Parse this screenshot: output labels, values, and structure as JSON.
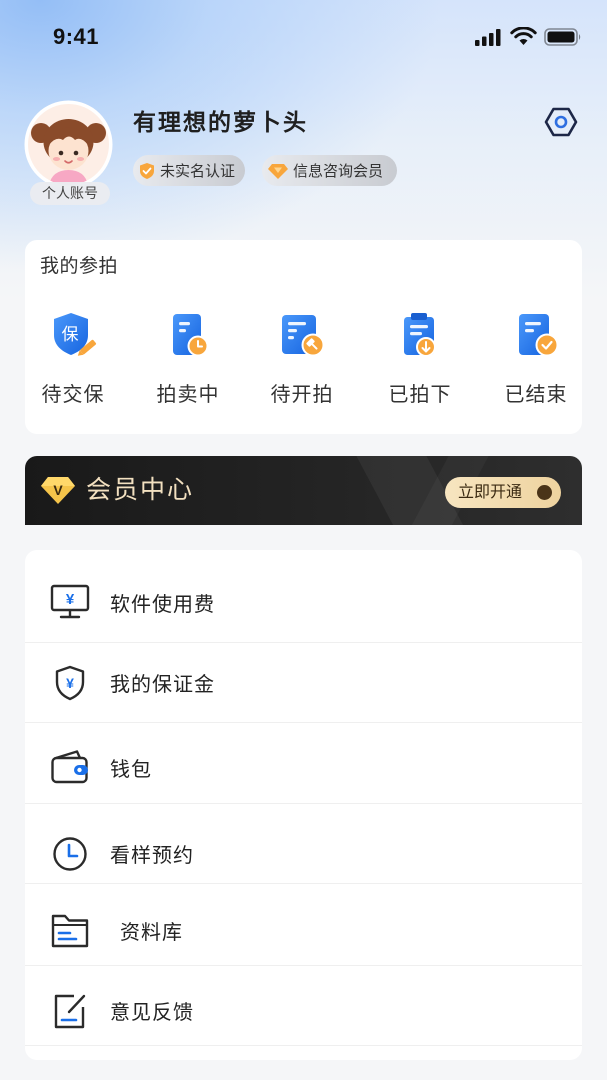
{
  "status_bar": {
    "time": "9:41"
  },
  "profile": {
    "username": "有理想的萝卜头",
    "account_label": "个人账号",
    "badges": [
      {
        "label": "未实名认证",
        "icon": "shield-icon"
      },
      {
        "label": "信息咨询会员",
        "icon": "diamond-icon"
      }
    ],
    "settings_icon": "settings-hexagon-icon"
  },
  "auction": {
    "title": "我的参拍",
    "items": [
      {
        "label": "待交保",
        "icon": "deposit-shield-icon",
        "glyph": "保"
      },
      {
        "label": "拍卖中",
        "icon": "document-clock-icon"
      },
      {
        "label": "待开拍",
        "icon": "document-hammer-icon"
      },
      {
        "label": "已拍下",
        "icon": "clipboard-download-icon"
      },
      {
        "label": "已结束",
        "icon": "document-check-icon"
      }
    ]
  },
  "membership": {
    "title": "会员中心",
    "badge_letter": "V",
    "cta_label": "立即开通"
  },
  "menu": {
    "currency_symbol": "¥",
    "items": [
      {
        "label": "软件使用费",
        "icon": "monitor-yen-icon"
      },
      {
        "label": "我的保证金",
        "icon": "shield-yen-icon"
      },
      {
        "label": "钱包",
        "icon": "wallet-icon"
      },
      {
        "label": "看样预约",
        "icon": "clock-icon"
      },
      {
        "label": "资料库",
        "icon": "folder-icon"
      },
      {
        "label": "意见反馈",
        "icon": "feedback-edit-icon"
      }
    ]
  },
  "colors": {
    "accent_blue": "#1a6fe8",
    "accent_orange": "#f8a63c",
    "vip_gold": "#f5c44a",
    "banner_text": "#f2e0c0",
    "cta_background": "#f6dfb4"
  }
}
